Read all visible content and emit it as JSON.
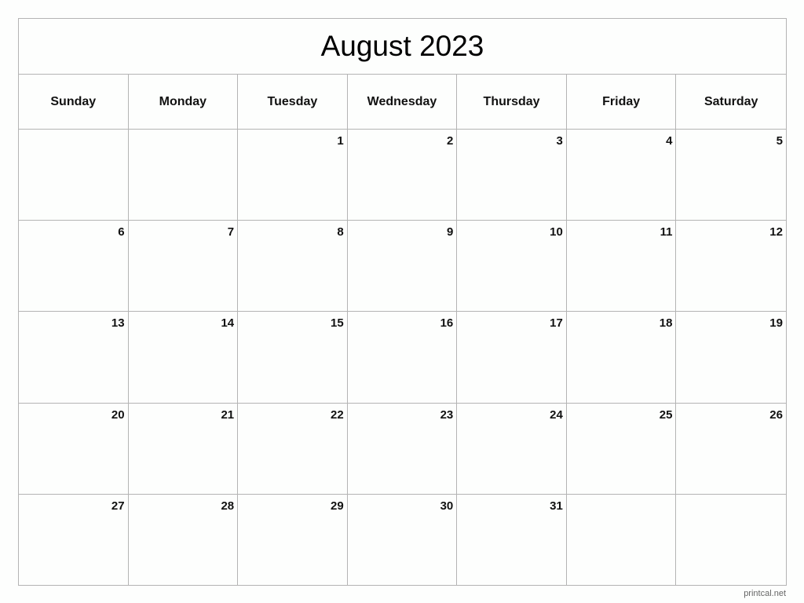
{
  "title": "August 2023",
  "weekdays": [
    "Sunday",
    "Monday",
    "Tuesday",
    "Wednesday",
    "Thursday",
    "Friday",
    "Saturday"
  ],
  "weeks": [
    [
      "",
      "",
      "1",
      "2",
      "3",
      "4",
      "5"
    ],
    [
      "6",
      "7",
      "8",
      "9",
      "10",
      "11",
      "12"
    ],
    [
      "13",
      "14",
      "15",
      "16",
      "17",
      "18",
      "19"
    ],
    [
      "20",
      "21",
      "22",
      "23",
      "24",
      "25",
      "26"
    ],
    [
      "27",
      "28",
      "29",
      "30",
      "31",
      "",
      ""
    ]
  ],
  "footer": "printcal.net"
}
